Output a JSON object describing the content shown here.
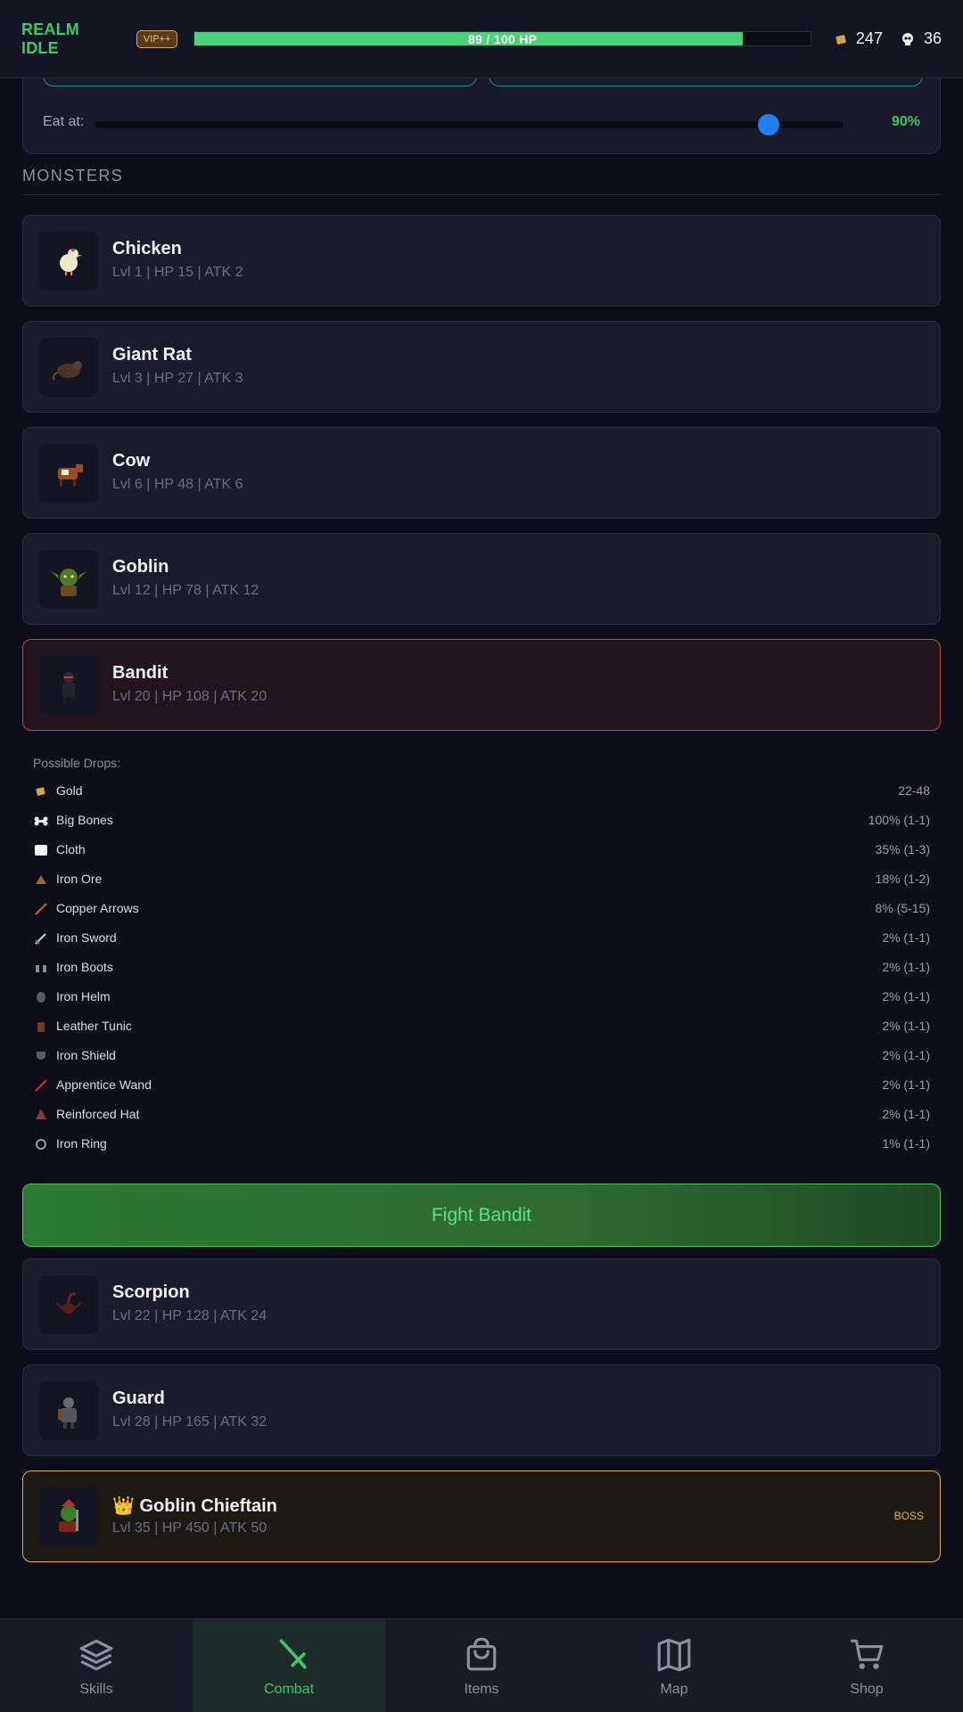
{
  "header": {
    "title": "REALM IDLE",
    "vip": "VIP++",
    "hp_text": "89 / 100 HP",
    "hp_fraction": 0.89,
    "gold": "247",
    "kills": "36"
  },
  "eat": {
    "label": "Eat at:",
    "value": "90%",
    "fraction": 0.9
  },
  "monsters_title": "MONSTERS",
  "monsters": [
    {
      "name": "Chicken",
      "stats": "Lvl 1 | HP 15 | ATK 2",
      "icon": "chicken-icon"
    },
    {
      "name": "Giant Rat",
      "stats": "Lvl 3 | HP 27 | ATK 3",
      "icon": "rat-icon"
    },
    {
      "name": "Cow",
      "stats": "Lvl 6 | HP 48 | ATK 6",
      "icon": "cow-icon"
    },
    {
      "name": "Goblin",
      "stats": "Lvl 12 | HP 78 | ATK 12",
      "icon": "goblin-icon"
    },
    {
      "name": "Bandit",
      "stats": "Lvl 20 | HP 108 | ATK 20",
      "icon": "bandit-icon",
      "selected": true
    },
    {
      "name": "Scorpion",
      "stats": "Lvl 22 | HP 128 | ATK 24",
      "icon": "scorpion-icon"
    },
    {
      "name": "Guard",
      "stats": "Lvl 28 | HP 165 | ATK 32",
      "icon": "guard-icon"
    },
    {
      "name": "👑 Goblin Chieftain",
      "stats": "Lvl 35 | HP 450 | ATK 50",
      "icon": "goblin-chieftain-icon",
      "tag": "BOSS"
    }
  ],
  "drops": {
    "title": "Possible Drops:",
    "items": [
      {
        "name": "Gold",
        "chance": "22-48",
        "icon": "gold-icon"
      },
      {
        "name": "Big Bones",
        "chance": "100% (1-1)",
        "icon": "bone-icon"
      },
      {
        "name": "Cloth",
        "chance": "35% (1-3)",
        "icon": "cloth-icon"
      },
      {
        "name": "Iron Ore",
        "chance": "18% (1-2)",
        "icon": "ore-icon"
      },
      {
        "name": "Copper Arrows",
        "chance": "8% (5-15)",
        "icon": "arrow-icon"
      },
      {
        "name": "Iron Sword",
        "chance": "2% (1-1)",
        "icon": "sword-icon"
      },
      {
        "name": "Iron Boots",
        "chance": "2% (1-1)",
        "icon": "boots-icon"
      },
      {
        "name": "Iron Helm",
        "chance": "2% (1-1)",
        "icon": "helm-icon"
      },
      {
        "name": "Leather Tunic",
        "chance": "2% (1-1)",
        "icon": "tunic-icon"
      },
      {
        "name": "Iron Shield",
        "chance": "2% (1-1)",
        "icon": "shield-icon"
      },
      {
        "name": "Apprentice Wand",
        "chance": "2% (1-1)",
        "icon": "wand-icon"
      },
      {
        "name": "Reinforced Hat",
        "chance": "2% (1-1)",
        "icon": "hat-icon"
      },
      {
        "name": "Iron Ring",
        "chance": "1% (1-1)",
        "icon": "ring-icon"
      }
    ]
  },
  "fight_button": "Fight Bandit",
  "nav": [
    {
      "label": "Skills",
      "icon": "layers-icon"
    },
    {
      "label": "Combat",
      "icon": "sword-icon",
      "active": true
    },
    {
      "label": "Items",
      "icon": "bag-icon"
    },
    {
      "label": "Map",
      "icon": "map-icon"
    },
    {
      "label": "Shop",
      "icon": "cart-icon"
    }
  ],
  "colors": {
    "accent": "#3ec86b",
    "selected_border": "#c9423e",
    "boss_border": "#d8b34e",
    "background": "#0d0e1a"
  }
}
